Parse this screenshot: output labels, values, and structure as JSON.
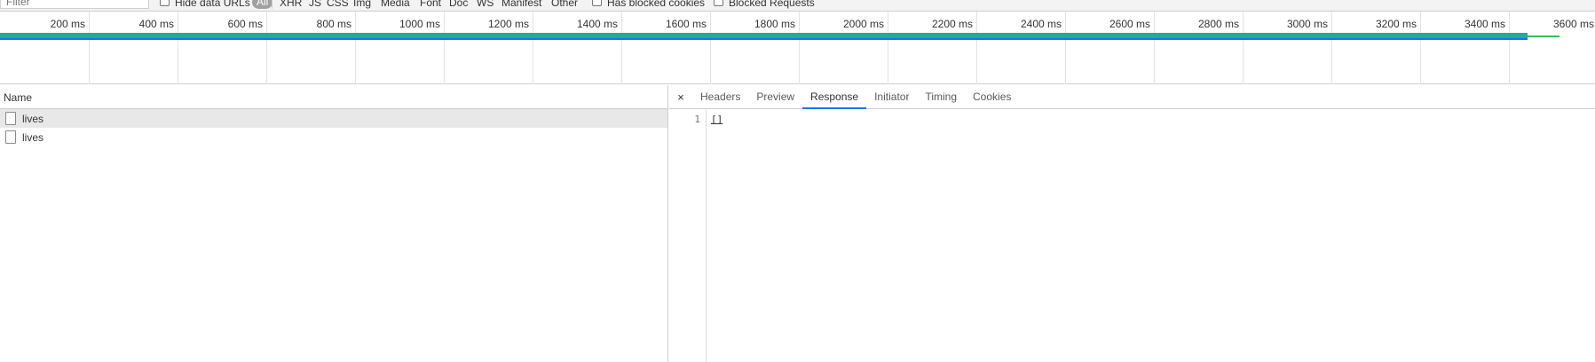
{
  "filterbar": {
    "filter_placeholder": "Filter",
    "hide_data_urls": "Hide data URLs",
    "types": [
      "All",
      "XHR",
      "JS",
      "CSS",
      "Img",
      "Media",
      "Font",
      "Doc",
      "WS",
      "Manifest",
      "Other"
    ],
    "has_blocked_cookies": "Has blocked cookies",
    "blocked_requests": "Blocked Requests"
  },
  "timeline": {
    "ticks": [
      "200 ms",
      "400 ms",
      "600 ms",
      "800 ms",
      "1000 ms",
      "1200 ms",
      "1400 ms",
      "1600 ms",
      "1800 ms",
      "2000 ms",
      "2200 ms",
      "2400 ms",
      "2600 ms",
      "2800 ms",
      "3000 ms",
      "3200 ms",
      "3400 ms",
      "3600 ms"
    ],
    "bar_color": "#1eaf8c",
    "tail_color": "#3cba54"
  },
  "request_list": {
    "header": "Name",
    "rows": [
      {
        "name": "lives",
        "selected": true
      },
      {
        "name": "lives",
        "selected": false
      }
    ]
  },
  "details": {
    "close": "×",
    "tabs": [
      "Headers",
      "Preview",
      "Response",
      "Initiator",
      "Timing",
      "Cookies"
    ],
    "active_tab": "Response",
    "accent": "#1a73e8",
    "line_number": "1",
    "content": "[]"
  }
}
